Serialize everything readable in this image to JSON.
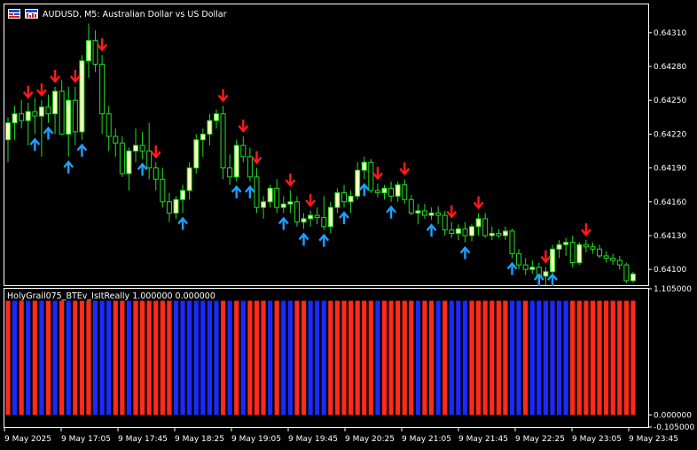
{
  "window": {
    "symbol_title": "AUDUSD, M5:  Australian Dollar vs US Dollar",
    "indicator_title": "HolyGrail075_BTEv_IsItReally 1.000000 0.000000"
  },
  "icons": [
    "chart-window-icon",
    "indicator-icon"
  ],
  "colors": {
    "background": "#000000",
    "grid_border": "#ffffff",
    "bull_candle": "#ffffc0",
    "bear_candle": "#000000",
    "wick": "#22dd22",
    "sell_arrow": "#ff1a1a",
    "buy_arrow": "#1ea0ff",
    "hist_red": "#ff2a1a",
    "hist_blue": "#1a2aff"
  },
  "chart_data": [
    {
      "type": "candlestick",
      "title": "AUDUSD, M5:  Australian Dollar vs US Dollar",
      "y_ticks": [
        "0.64310",
        "0.64280",
        "0.64250",
        "0.64220",
        "0.64190",
        "0.64160",
        "0.64130",
        "0.64100"
      ],
      "ylim": [
        0.64086,
        0.64335
      ],
      "x_tick_labels": [
        "9 May 2025",
        "9 May 17:05",
        "9 May 17:45",
        "9 May 18:25",
        "9 May 19:05",
        "9 May 19:45",
        "9 May 20:25",
        "9 May 21:05",
        "9 May 21:45",
        "9 May 22:25",
        "9 May 23:05",
        "9 May 23:45"
      ],
      "candles": [
        [
          0.64215,
          0.64235,
          0.64195,
          0.6423
        ],
        [
          0.6423,
          0.64245,
          0.64215,
          0.64238
        ],
        [
          0.64238,
          0.6425,
          0.64225,
          0.64232
        ],
        [
          0.64232,
          0.64248,
          0.6421,
          0.6424
        ],
        [
          0.6424,
          0.64252,
          0.6422,
          0.64236
        ],
        [
          0.64236,
          0.6425,
          0.642,
          0.64244
        ],
        [
          0.64244,
          0.64255,
          0.6423,
          0.64238
        ],
        [
          0.64238,
          0.64262,
          0.6422,
          0.64258
        ],
        [
          0.64258,
          0.64268,
          0.6423,
          0.6422
        ],
        [
          0.6422,
          0.64262,
          0.642,
          0.6425
        ],
        [
          0.6425,
          0.64262,
          0.6421,
          0.64222
        ],
        [
          0.64222,
          0.6429,
          0.64215,
          0.64285
        ],
        [
          0.64285,
          0.64318,
          0.6427,
          0.64303
        ],
        [
          0.64303,
          0.64312,
          0.64275,
          0.64282
        ],
        [
          0.64282,
          0.6429,
          0.6422,
          0.64238
        ],
        [
          0.64238,
          0.64245,
          0.64205,
          0.64218
        ],
        [
          0.64218,
          0.64225,
          0.642,
          0.64212
        ],
        [
          0.64212,
          0.64218,
          0.64182,
          0.64185
        ],
        [
          0.64185,
          0.64208,
          0.6417,
          0.64205
        ],
        [
          0.64205,
          0.64225,
          0.64195,
          0.6421
        ],
        [
          0.6421,
          0.64222,
          0.64198,
          0.64205
        ],
        [
          0.64205,
          0.6423,
          0.6418,
          0.6419
        ],
        [
          0.6419,
          0.64195,
          0.6417,
          0.6418
        ],
        [
          0.6418,
          0.6419,
          0.64155,
          0.6416
        ],
        [
          0.6416,
          0.64168,
          0.64142,
          0.6415
        ],
        [
          0.6415,
          0.64165,
          0.64145,
          0.64162
        ],
        [
          0.64162,
          0.64175,
          0.6415,
          0.6417
        ],
        [
          0.6417,
          0.64195,
          0.64162,
          0.6419
        ],
        [
          0.6419,
          0.6422,
          0.64185,
          0.64215
        ],
        [
          0.64215,
          0.64225,
          0.642,
          0.6422
        ],
        [
          0.6422,
          0.64238,
          0.6421,
          0.64232
        ],
        [
          0.64232,
          0.64242,
          0.64225,
          0.64238
        ],
        [
          0.64238,
          0.64245,
          0.6418,
          0.6419
        ],
        [
          0.6419,
          0.64202,
          0.64175,
          0.64182
        ],
        [
          0.64182,
          0.64215,
          0.64178,
          0.6421
        ],
        [
          0.6421,
          0.64218,
          0.64195,
          0.642
        ],
        [
          0.642,
          0.64208,
          0.64178,
          0.64182
        ],
        [
          0.64182,
          0.6419,
          0.6415,
          0.64155
        ],
        [
          0.64155,
          0.64165,
          0.64145,
          0.6416
        ],
        [
          0.6416,
          0.64175,
          0.64155,
          0.64172
        ],
        [
          0.64172,
          0.6418,
          0.6415,
          0.64155
        ],
        [
          0.64155,
          0.64165,
          0.6415,
          0.64158
        ],
        [
          0.64158,
          0.6417,
          0.6415,
          0.6416
        ],
        [
          0.6416,
          0.64165,
          0.64138,
          0.64142
        ],
        [
          0.64142,
          0.6415,
          0.64136,
          0.64145
        ],
        [
          0.64145,
          0.64152,
          0.64138,
          0.64148
        ],
        [
          0.64148,
          0.64155,
          0.6414,
          0.64146
        ],
        [
          0.64146,
          0.64165,
          0.64135,
          0.64138
        ],
        [
          0.64138,
          0.6416,
          0.64132,
          0.64155
        ],
        [
          0.64155,
          0.64172,
          0.6415,
          0.64168
        ],
        [
          0.64168,
          0.64175,
          0.64155,
          0.6416
        ],
        [
          0.6416,
          0.6417,
          0.6415,
          0.64165
        ],
        [
          0.64165,
          0.64195,
          0.64162,
          0.64188
        ],
        [
          0.64188,
          0.642,
          0.6418,
          0.64195
        ],
        [
          0.64195,
          0.64198,
          0.64168,
          0.6417
        ],
        [
          0.6417,
          0.64176,
          0.64164,
          0.64168
        ],
        [
          0.64168,
          0.64175,
          0.64162,
          0.64172
        ],
        [
          0.64172,
          0.64178,
          0.6416,
          0.64165
        ],
        [
          0.64165,
          0.64178,
          0.6416,
          0.64175
        ],
        [
          0.64175,
          0.6418,
          0.64158,
          0.64162
        ],
        [
          0.64162,
          0.64166,
          0.64148,
          0.6415
        ],
        [
          0.6415,
          0.64158,
          0.6414,
          0.64152
        ],
        [
          0.64152,
          0.64158,
          0.64145,
          0.64148
        ],
        [
          0.64148,
          0.64155,
          0.64144,
          0.6415
        ],
        [
          0.6415,
          0.64156,
          0.6414,
          0.64148
        ],
        [
          0.64148,
          0.64152,
          0.6413,
          0.64135
        ],
        [
          0.64135,
          0.64142,
          0.64128,
          0.64132
        ],
        [
          0.64132,
          0.6414,
          0.64126,
          0.64136
        ],
        [
          0.64136,
          0.64142,
          0.64124,
          0.6413
        ],
        [
          0.6413,
          0.6414,
          0.64125,
          0.64138
        ],
        [
          0.64138,
          0.6415,
          0.6413,
          0.64145
        ],
        [
          0.64145,
          0.6415,
          0.64128,
          0.6413
        ],
        [
          0.6413,
          0.64138,
          0.64126,
          0.64132
        ],
        [
          0.64132,
          0.64136,
          0.64128,
          0.6413
        ],
        [
          0.6413,
          0.64138,
          0.64126,
          0.64134
        ],
        [
          0.64134,
          0.64136,
          0.6411,
          0.64114
        ],
        [
          0.64114,
          0.64118,
          0.641,
          0.64104
        ],
        [
          0.64104,
          0.6411,
          0.64095,
          0.641
        ],
        [
          0.641,
          0.64108,
          0.64096,
          0.64102
        ],
        [
          0.64102,
          0.64106,
          0.6409,
          0.64094
        ],
        [
          0.64094,
          0.64102,
          0.64086,
          0.64098
        ],
        [
          0.64098,
          0.64122,
          0.64094,
          0.64118
        ],
        [
          0.64118,
          0.64126,
          0.6411,
          0.64122
        ],
        [
          0.64122,
          0.64128,
          0.64112,
          0.64124
        ],
        [
          0.64124,
          0.6413,
          0.64102,
          0.64106
        ],
        [
          0.64106,
          0.64124,
          0.64104,
          0.64122
        ],
        [
          0.64122,
          0.64126,
          0.64115,
          0.6412
        ],
        [
          0.6412,
          0.64124,
          0.64114,
          0.64118
        ],
        [
          0.64118,
          0.64122,
          0.6411,
          0.64112
        ],
        [
          0.64112,
          0.64116,
          0.64106,
          0.6411
        ],
        [
          0.6411,
          0.64114,
          0.64104,
          0.64108
        ],
        [
          0.64108,
          0.64112,
          0.641,
          0.64104
        ],
        [
          0.64104,
          0.64106,
          0.64088,
          0.6409
        ],
        [
          0.6409,
          0.64098,
          0.64088,
          0.64096
        ]
      ],
      "sell_arrows": [
        3,
        5,
        7,
        10,
        14,
        22,
        32,
        35,
        37,
        42,
        45,
        55,
        59,
        66,
        70,
        80,
        86
      ],
      "buy_arrows": [
        4,
        6,
        9,
        11,
        20,
        26,
        34,
        36,
        41,
        44,
        47,
        50,
        53,
        57,
        63,
        68,
        75,
        79,
        81
      ]
    },
    {
      "type": "bar",
      "title": "HolyGrail075_BTEv_IsItReally 1.000000 0.000000",
      "y_ticks": [
        "1.105000",
        "0.000000",
        "-0.105000"
      ],
      "ylim": [
        -0.105,
        1.105
      ],
      "values": [
        1,
        1,
        1,
        1,
        1,
        1,
        1,
        1,
        1,
        1,
        1,
        1,
        1,
        1,
        1,
        1,
        1,
        1,
        1,
        1,
        1,
        1,
        1,
        1,
        1,
        1,
        1,
        1,
        1,
        1,
        1,
        1,
        1,
        1,
        1,
        1,
        1,
        1,
        1,
        1,
        1,
        1,
        1,
        1,
        1,
        1,
        1,
        1,
        1,
        1,
        1,
        1,
        1,
        1,
        1,
        1,
        1,
        1,
        1,
        1,
        1,
        1,
        1,
        1,
        1,
        1,
        1,
        1,
        1,
        1,
        1,
        1,
        1,
        1,
        1,
        1,
        1,
        1,
        1,
        1,
        1,
        1,
        1,
        1,
        1,
        1,
        1,
        1,
        1,
        1,
        1,
        1,
        1,
        1
      ],
      "colors": "rbrbrbrbrbrrrbbbrrbrrrrrrbbbbbbbrbrbrrrbrbbrrbbbrrrrrrrbrrrrrbrrbrbbbrrrrrrbbrbbbbbbrrrrrrrrr"
    }
  ]
}
